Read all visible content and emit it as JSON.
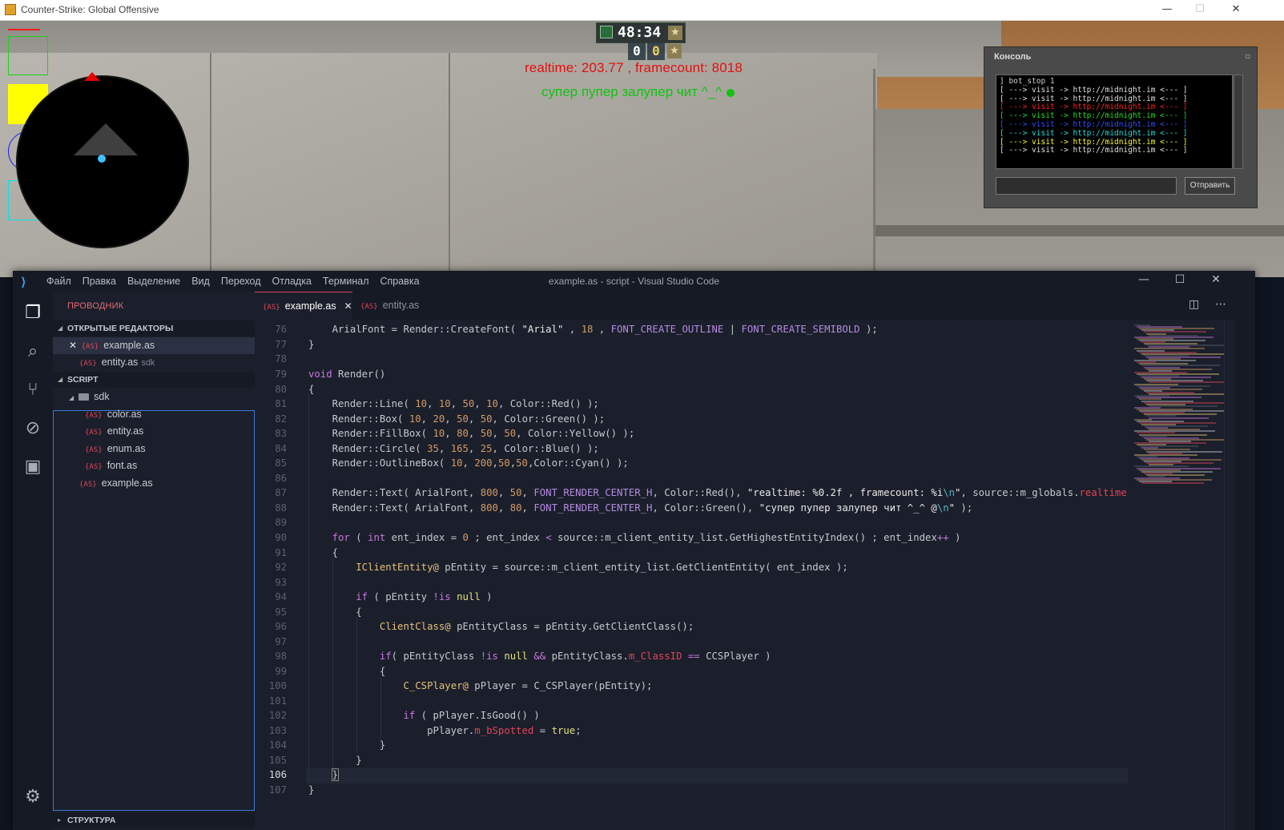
{
  "game": {
    "window_title": "Counter-Strike: Global Offensive",
    "controls": {
      "minimize": "—",
      "maximize": "☐",
      "close": "✕"
    },
    "hud": {
      "round_time": "48:34",
      "score_ct": "0",
      "score_t": "0"
    },
    "overlay": {
      "realtime_text": "realtime: 203.77 , framecount: 8018",
      "green_text": "супер пупер залупер чит ^_^"
    },
    "draw_colors": {
      "line": "#ff1a1a",
      "box": "#1ad21a",
      "fillbox": "#ffff00",
      "circle": "#1a1aff",
      "outlinebox": "#00e5e5"
    },
    "console": {
      "title": "Консоль",
      "log": [
        {
          "text": "] bot_stop 1",
          "color": "#d0d0d0"
        },
        {
          "text": "[ ---> visit -> http://midnight.im <--- ]",
          "color": "#e0e0e0"
        },
        {
          "text": "[ ---> visit -> http://midnight.im <--- ]",
          "color": "#e0e0e0"
        },
        {
          "text": "[ ---> visit -> http://midnight.im <--- ]",
          "color": "#ff2020"
        },
        {
          "text": "[ ---> visit -> http://midnight.im <--- ]",
          "color": "#20e020"
        },
        {
          "text": "[ ---> visit -> http://midnight.im <--- ]",
          "color": "#3050ff"
        },
        {
          "text": "[ ---> visit -> http://midnight.im <--- ]",
          "color": "#20e0e0"
        },
        {
          "text": "[ ---> visit -> http://midnight.im <--- ]",
          "color": "#ffff30"
        },
        {
          "text": "[ ---> visit -> http://midnight.im <--- ]",
          "color": "#e0e0e0"
        }
      ],
      "input_value": "",
      "send_label": "Отправить"
    }
  },
  "vscode": {
    "window_title": "example.as - script - Visual Studio Code",
    "menu": [
      "Файл",
      "Правка",
      "Выделение",
      "Вид",
      "Переход",
      "Отладка",
      "Терминал",
      "Справка"
    ],
    "controls": {
      "minimize": "—",
      "maximize": "☐",
      "close": "✕"
    },
    "activity": {
      "explorer_icon": "files-icon",
      "search_icon": "search-icon",
      "scm_icon": "source-control-icon",
      "debug_icon": "debug-icon",
      "extensions_icon": "extensions-icon",
      "settings_icon": "gear-icon"
    },
    "sidebar": {
      "title": "ПРОВОДНИК",
      "open_editors_label": "ОТКРЫТЫЕ РЕДАКТОРЫ",
      "open_editors": [
        {
          "name": "example.as",
          "hint": ""
        },
        {
          "name": "entity.as",
          "hint": "sdk"
        }
      ],
      "script_label": "SCRIPT",
      "folder": "sdk",
      "sdk_files": [
        "color.as",
        "entity.as",
        "enum.as",
        "font.as"
      ],
      "root_files": [
        "example.as"
      ],
      "outline_label": "СТРУКТУРА",
      "file_badge": "{AS}"
    },
    "tabs": [
      {
        "name": "example.as",
        "active": true
      },
      {
        "name": "entity.as",
        "active": false
      }
    ],
    "current_line": 106,
    "line_numbers": [
      "76",
      "77",
      "78",
      "79",
      "80",
      "81",
      "82",
      "83",
      "84",
      "85",
      "86",
      "87",
      "88",
      "89",
      "90",
      "91",
      "92",
      "93",
      "94",
      "95",
      "96",
      "97",
      "98",
      "99",
      "100",
      "101",
      "102",
      "103",
      "104",
      "105",
      "106",
      "107"
    ]
  }
}
